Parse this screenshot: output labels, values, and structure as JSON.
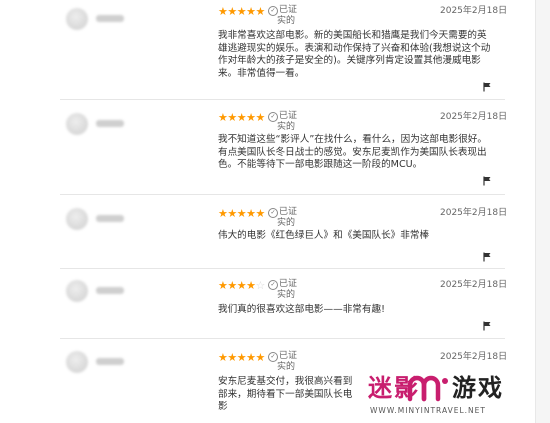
{
  "reviews": [
    {
      "rating": 5,
      "stars": "★★★★★",
      "verified_line1": "已证",
      "verified_line2": "实的",
      "date": "2025年2月18日",
      "text": "我非常喜欢这部电影。新的美国船长和猎鹰是我们今天需要的英雄逃避现实的娱乐。表演和动作保持了兴奋和体验(我想说这个动作对年龄大的孩子是安全的)。关键序列肯定设置其他漫威电影来。非常值得一看。"
    },
    {
      "rating": 5,
      "stars": "★★★★★",
      "verified_line1": "已证",
      "verified_line2": "实的",
      "date": "2025年2月18日",
      "text": "我不知道这些“影评人”在找什么，看什么，因为这部电影很好。有点美国队长冬日战士的感觉。安东尼麦凯作为美国队长表现出色。不能等待下一部电影跟随这一阶段的MCU。"
    },
    {
      "rating": 5,
      "stars": "★★★★★",
      "verified_line1": "已证",
      "verified_line2": "实的",
      "date": "2025年2月18日",
      "text": "伟大的电影《红色绿巨人》和《美国队长》非常棒"
    },
    {
      "rating": 4,
      "stars": "★★★★",
      "stars_off": "☆",
      "verified_line1": "已证",
      "verified_line2": "实的",
      "date": "2025年2月18日",
      "text": "我们真的很喜欢这部电影——非常有趣!"
    },
    {
      "rating": 5,
      "stars": "★★★★★",
      "verified_line1": "已证",
      "verified_line2": "实的",
      "date": "2025年2月18日",
      "text": "安东尼麦基交付，我很高兴看到部来，期待看下一部美国队长电影"
    }
  ],
  "watermark": {
    "brand_part1": "迷影",
    "brand_part2": "游戏",
    "url": "WWW.MINYINTRAVEL.NET"
  },
  "colors": {
    "star": "#ff9900",
    "brand_pink": "#c81e6e",
    "text": "#333333"
  }
}
